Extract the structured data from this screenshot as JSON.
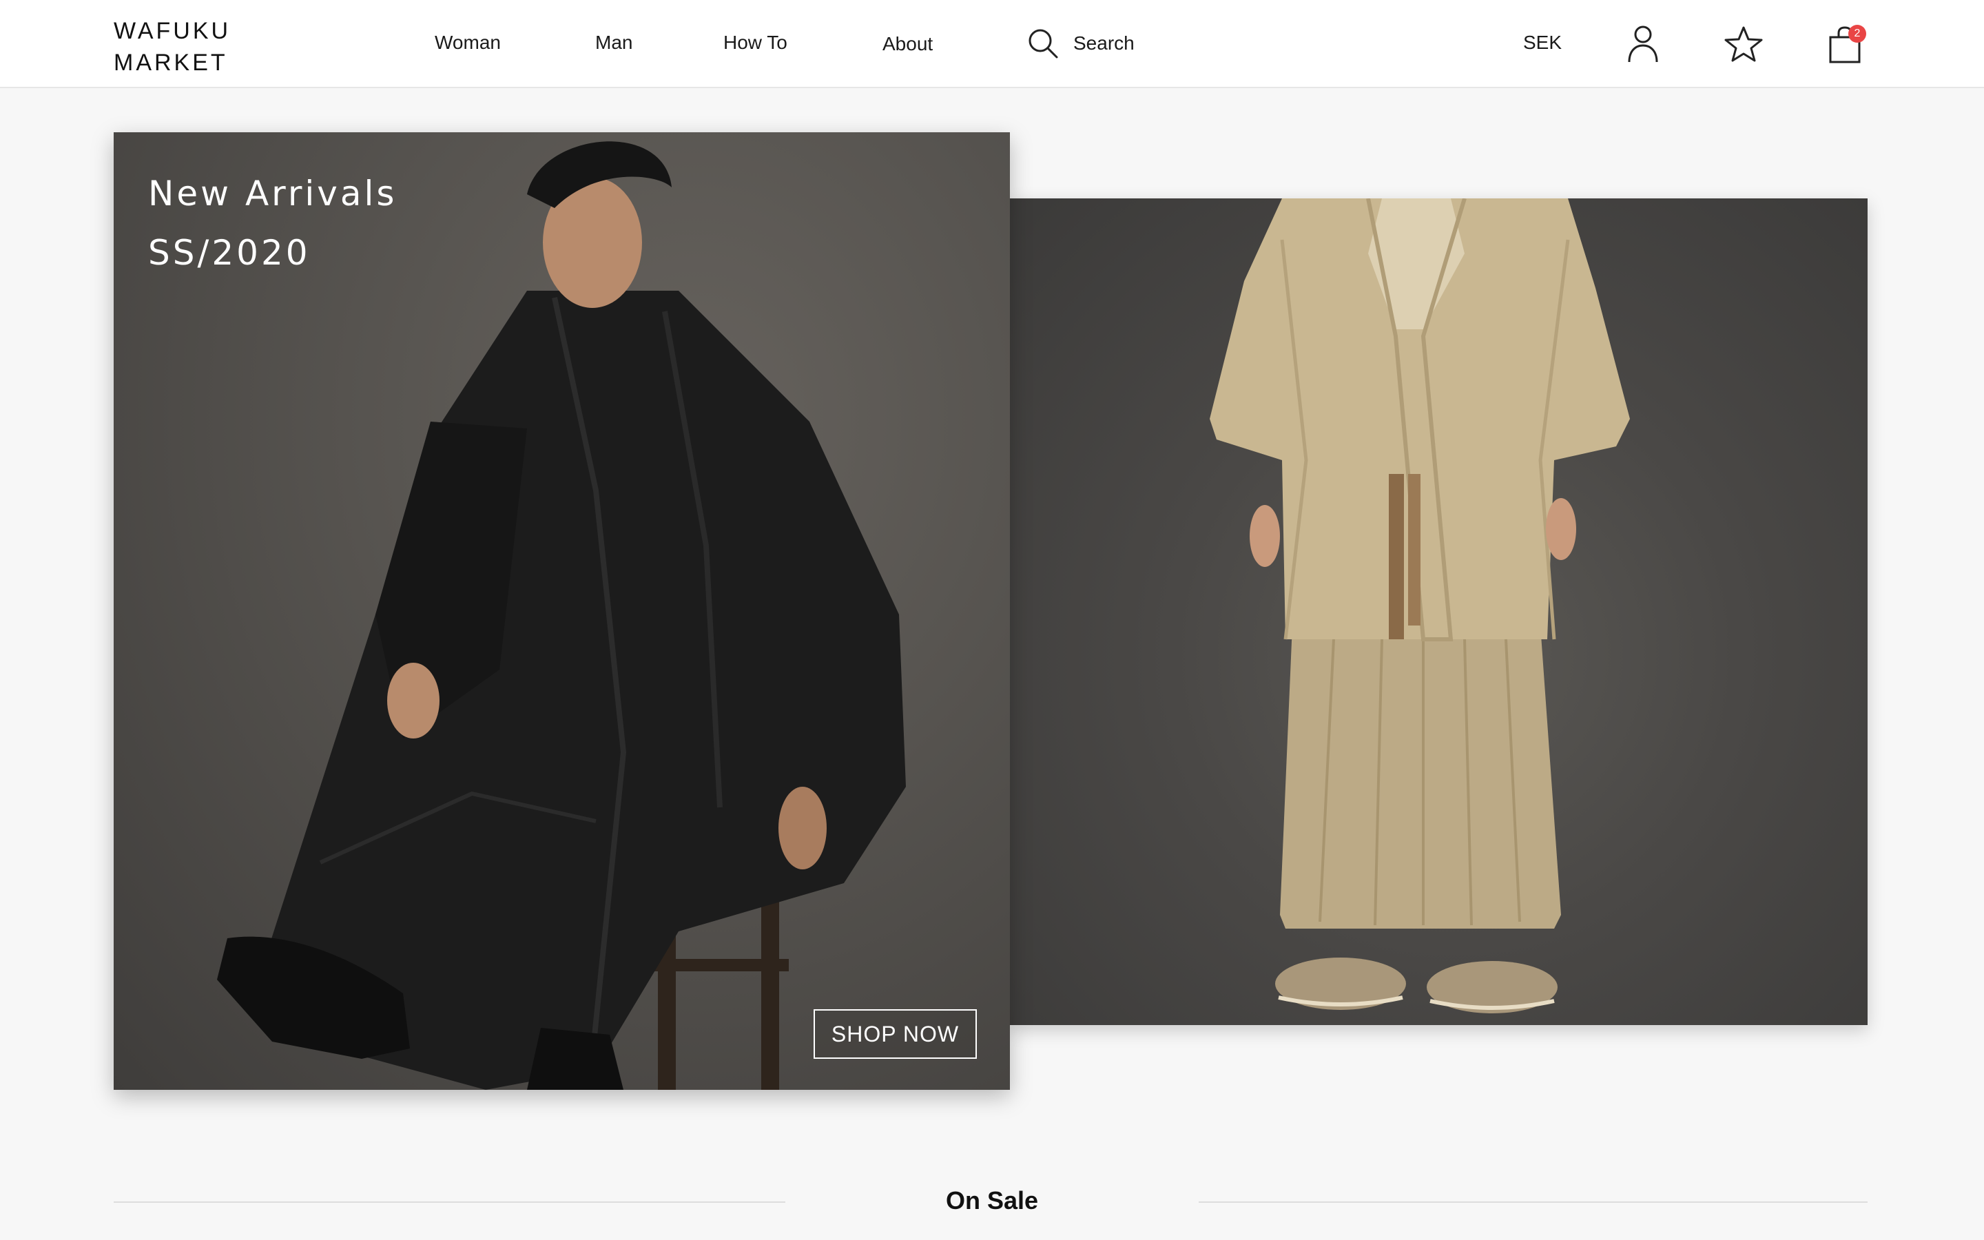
{
  "brand": {
    "line1": "WAFUKU",
    "line2": "MARKET"
  },
  "nav": {
    "items": [
      {
        "label": "Woman"
      },
      {
        "label": "Man"
      },
      {
        "label": "How To"
      },
      {
        "label": "About"
      }
    ],
    "search_label": "Search"
  },
  "header_actions": {
    "currency": "SEK",
    "icons": [
      "user-icon",
      "star-icon",
      "shopping-bag-icon"
    ],
    "cart_count": "2",
    "badge_color": "#e94545"
  },
  "hero": {
    "title_line1": "New Arrivals",
    "title_line2": "SS/2020",
    "cta_label": "SHOP NOW",
    "images": [
      "man-in-black-kimono-hakama-seated",
      "man-in-beige-haori-hakama-standing"
    ]
  },
  "section": {
    "title": "On Sale"
  }
}
